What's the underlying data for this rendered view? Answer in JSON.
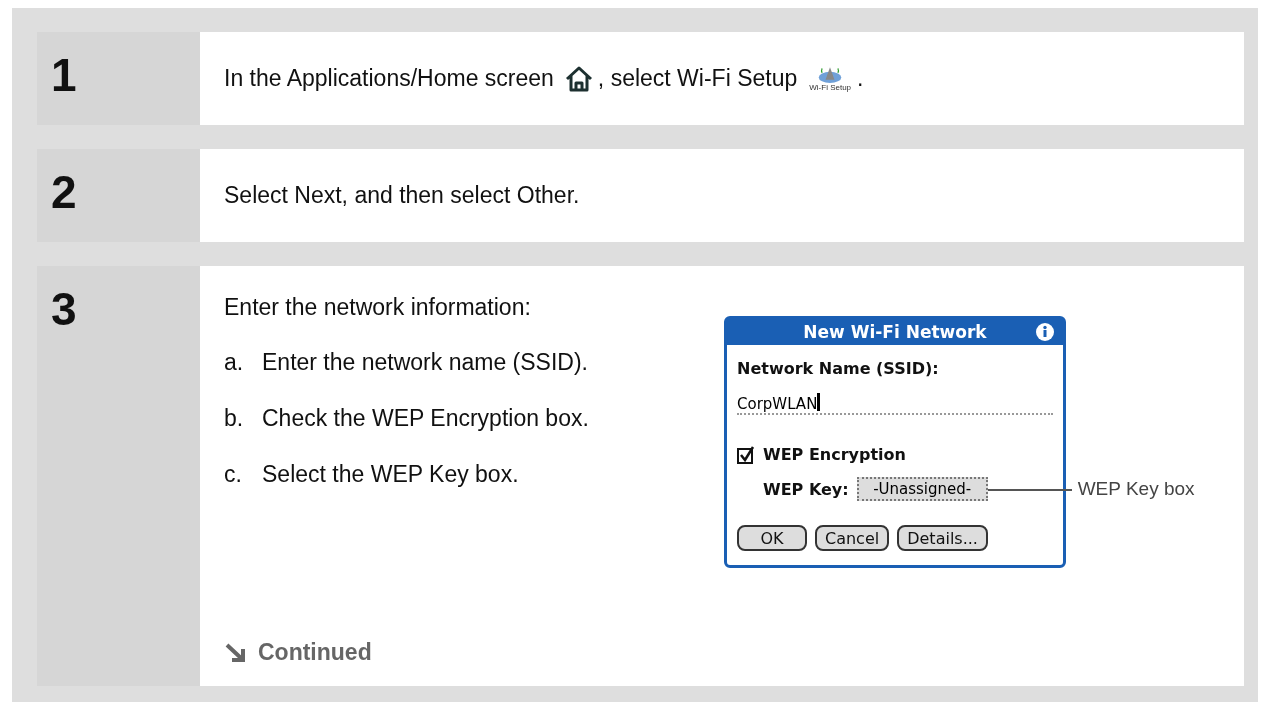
{
  "steps": [
    {
      "number": "1",
      "kind": "icons",
      "text_before": "In the Applications/Home screen",
      "text_middle": ", select Wi-Fi Setup",
      "app_icon_label": "Wi-Fi Setup",
      "text_after": "."
    },
    {
      "number": "2",
      "kind": "plain",
      "text": "Select Next, and then select Other."
    },
    {
      "number": "3",
      "kind": "dialog",
      "intro": "Enter the network information:",
      "substeps": [
        {
          "letter": "a.",
          "text": "Enter the network name (SSID)."
        },
        {
          "letter": "b.",
          "text": "Check the WEP Encryption box."
        },
        {
          "letter": "c.",
          "text": "Select the WEP Key box."
        }
      ],
      "continued": "Continued",
      "dialog": {
        "title": "New Wi-Fi Network",
        "name_label": "Network Name (SSID):",
        "name_value": "CorpWLAN",
        "wep_checked": true,
        "wep_label": "WEP Encryption",
        "key_label": "WEP Key:",
        "key_value": "-Unassigned-",
        "buttons": [
          "OK",
          "Cancel",
          "Details..."
        ]
      },
      "callout": "WEP Key box"
    }
  ]
}
